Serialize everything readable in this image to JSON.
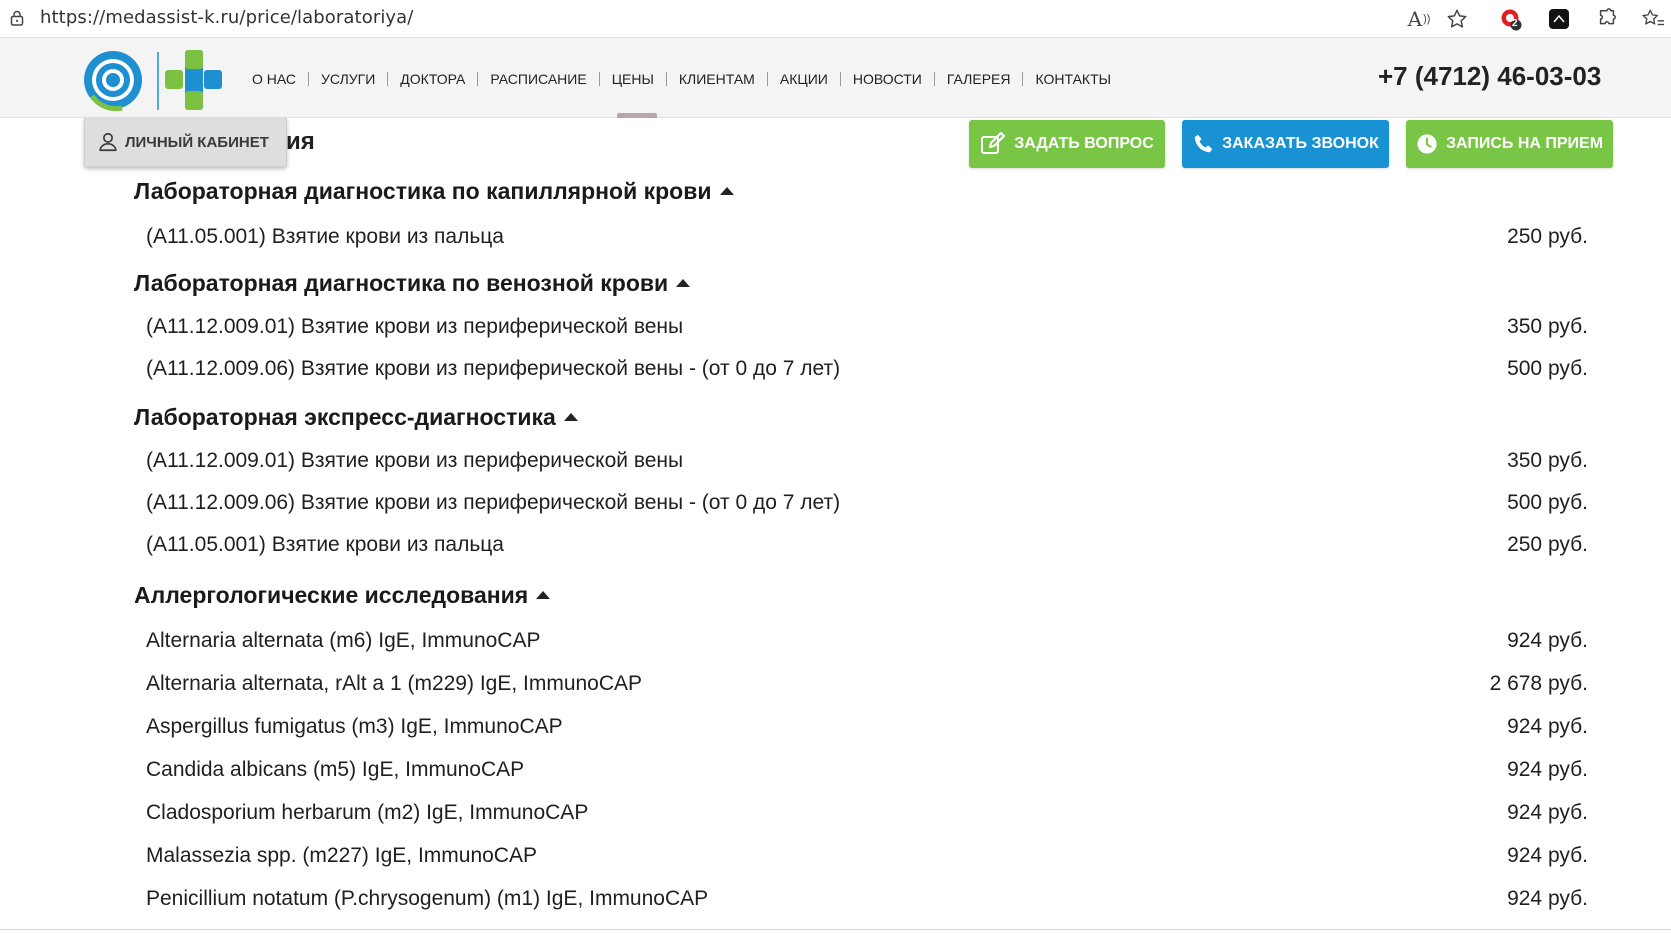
{
  "browser": {
    "url": "https://medassist-k.ru/price/laboratoriya/",
    "read_aloud_label": "A",
    "extension_badge": "2"
  },
  "header": {
    "nav": [
      {
        "label": "О НАС"
      },
      {
        "label": "УСЛУГИ"
      },
      {
        "label": "ДОКТОРА"
      },
      {
        "label": "РАСПИСАНИЕ"
      },
      {
        "label": "ЦЕНЫ",
        "active": true
      },
      {
        "label": "КЛИЕНТАМ"
      },
      {
        "label": "АКЦИИ"
      },
      {
        "label": "НОВОСТИ"
      },
      {
        "label": "ГАЛЕРЕЯ"
      },
      {
        "label": "КОНТАКТЫ"
      }
    ],
    "phone": "+7 (4712) 46-03-03",
    "cabinet_label": "ЛИЧНЫЙ КАБИНЕТ",
    "partial_title": "ия",
    "buttons": {
      "question": "ЗАДАТЬ ВОПРОС",
      "call": "ЗАКАЗАТЬ ЗВОНОК",
      "appointment": "ЗАПИСЬ НА ПРИЕМ"
    }
  },
  "colors": {
    "green_button": "#79c545",
    "blue_button": "#1992d4",
    "logo_blue": "#1e8fd0",
    "logo_green": "#7cc142"
  },
  "sections": [
    {
      "title": "Лабораторная диагностика по капиллярной крови",
      "items": [
        {
          "name": "(A11.05.001) Взятие крови из пальца",
          "price": "250 руб."
        }
      ]
    },
    {
      "title": "Лабораторная диагностика по венозной крови",
      "items": [
        {
          "name": "(A11.12.009.01) Взятие крови из периферической вены",
          "price": "350 руб."
        },
        {
          "name": "(A11.12.009.06) Взятие крови из периферической вены - (от 0 до 7 лет)",
          "price": "500 руб."
        }
      ]
    },
    {
      "title": "Лабораторная экспресс-диагностика",
      "items": [
        {
          "name": "(A11.12.009.01) Взятие крови из периферической вены",
          "price": "350 руб."
        },
        {
          "name": "(A11.12.009.06) Взятие крови из периферической вены - (от 0 до 7 лет)",
          "price": "500 руб."
        },
        {
          "name": "(A11.05.001) Взятие крови из пальца",
          "price": "250 руб."
        }
      ]
    },
    {
      "title": "Аллергологические исследования",
      "items": [
        {
          "name": "Alternaria alternata (m6) IgE, ImmunoCAP",
          "price": "924 руб."
        },
        {
          "name": "Alternaria alternata, rAlt a 1 (m229) IgE, ImmunoCAP",
          "price": "2 678 руб."
        },
        {
          "name": "Aspergillus fumigatus (m3) IgE, ImmunoCAP",
          "price": "924 руб."
        },
        {
          "name": "Candida albicans (m5) IgE, ImmunoCAP",
          "price": "924 руб."
        },
        {
          "name": "Cladosporium herbarum (m2) IgE, ImmunoCAP",
          "price": "924 руб."
        },
        {
          "name": "Malassezia spp. (m227) IgE, ImmunoCAP",
          "price": "924 руб."
        },
        {
          "name": "Penicillium notatum (P.chrysogenum) (m1) IgE, ImmunoCAP",
          "price": "924 руб."
        }
      ]
    }
  ]
}
